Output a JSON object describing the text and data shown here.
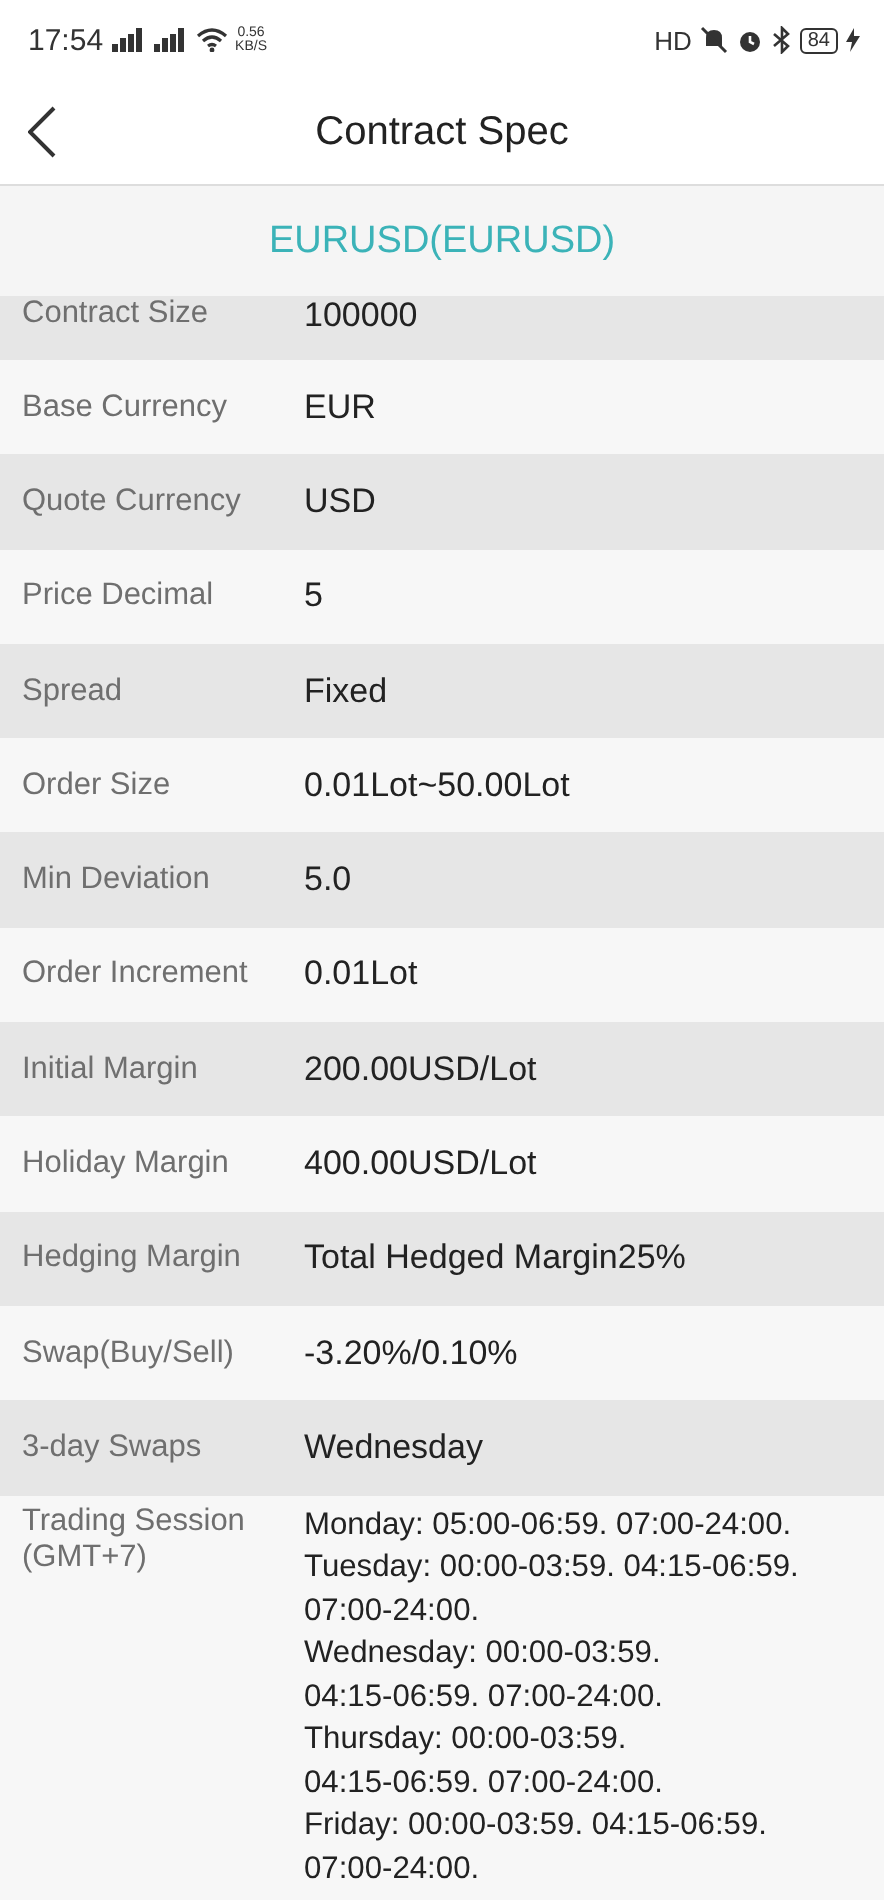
{
  "status_bar": {
    "time": "17:54",
    "speed_value": "0.56",
    "speed_unit": "KB/S",
    "hd": "HD",
    "battery": "84"
  },
  "header": {
    "title": "Contract Spec"
  },
  "symbol": "EURUSD(EURUSD)",
  "rows": [
    {
      "label": "Contract Size",
      "value": "100000",
      "partial": true
    },
    {
      "label": "Base Currency",
      "value": "EUR"
    },
    {
      "label": "Quote Currency",
      "value": "USD"
    },
    {
      "label": "Price Decimal",
      "value": "5"
    },
    {
      "label": "Spread",
      "value": "Fixed"
    },
    {
      "label": "Order Size",
      "value": "0.01Lot~50.00Lot"
    },
    {
      "label": "Min Deviation",
      "value": "5.0"
    },
    {
      "label": "Order Increment",
      "value": "0.01Lot"
    },
    {
      "label": "Initial Margin",
      "value": "200.00USD/Lot"
    },
    {
      "label": "Holiday Margin",
      "value": "400.00USD/Lot"
    },
    {
      "label": "Hedging Margin",
      "value": "Total Hedged Margin25%"
    },
    {
      "label": "Swap(Buy/Sell)",
      "value": "-3.20%/0.10%"
    },
    {
      "label": "3-day Swaps",
      "value": "Wednesday"
    }
  ],
  "trading_session": {
    "label": "Trading Session (GMT+7)",
    "lines": [
      "Monday: 05:00-06:59. 07:00-24:00.",
      "Tuesday: 00:00-03:59. 04:15-06:59.",
      "07:00-24:00.",
      "Wednesday: 00:00-03:59.",
      "04:15-06:59. 07:00-24:00.",
      "Thursday: 00:00-03:59.",
      "04:15-06:59. 07:00-24:00.",
      "Friday: 00:00-03:59. 04:15-06:59.",
      "07:00-24:00."
    ]
  }
}
